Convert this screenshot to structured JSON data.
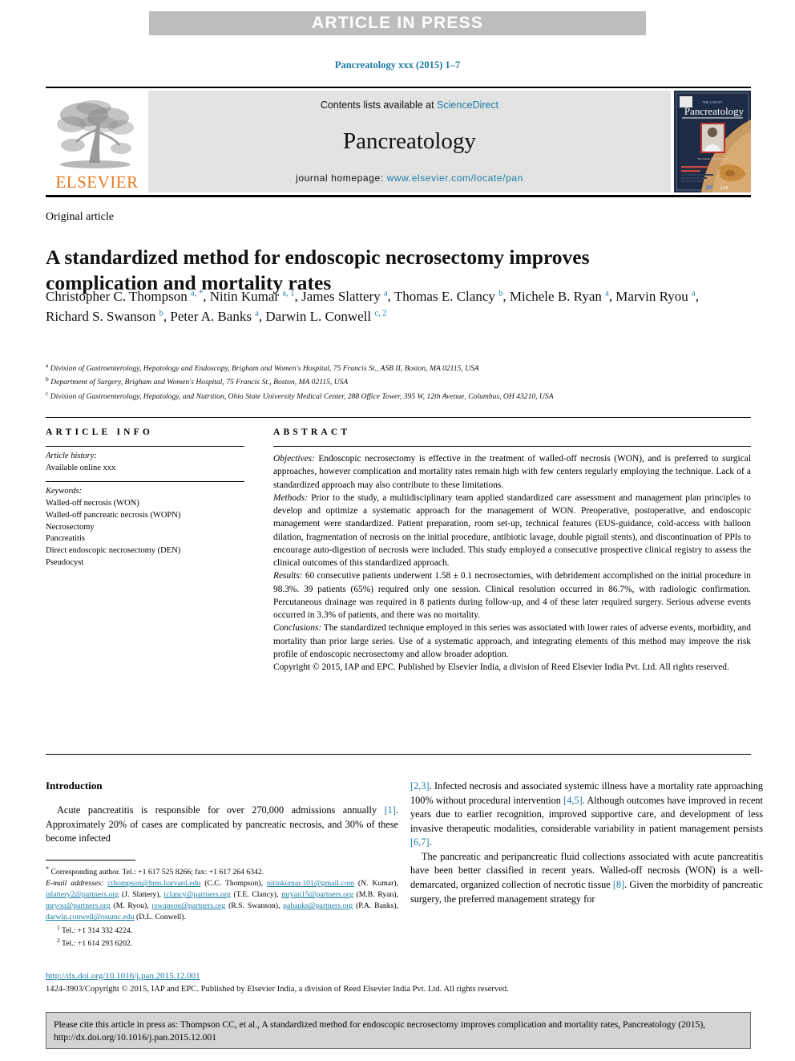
{
  "banner": {
    "text": "ARTICLE IN PRESS"
  },
  "journal_ref": "Pancreatology xxx (2015) 1–7",
  "masthead": {
    "publisher_word": "ELSEVIER",
    "contents_prefix": "Contents lists available at ",
    "contents_link": "ScienceDirect",
    "journal_name": "Pancreatology",
    "homepage_prefix": "journal homepage: ",
    "homepage_link": "www.elsevier.com/locate/pan",
    "cover_title": "Pancreatology",
    "cover_top_label": "THE LANCET"
  },
  "article": {
    "doctype": "Original article",
    "title": "A standardized method for endoscopic necrosectomy improves complication and mortality rates",
    "authors_html": "Christopher C. Thompson <sup>a, *</sup>, Nitin Kumar <sup>a, 1</sup>, James Slattery <sup>a</sup>, Thomas E. Clancy <sup>b</sup>, Michele B. Ryan <sup>a</sup>, Marvin Ryou <sup>a</sup>, Richard S. Swanson <sup>b</sup>, Peter A. Banks <sup>a</sup>, Darwin L. Conwell <sup>c, 2</sup>",
    "affiliations": [
      {
        "marker": "a",
        "text": "Division of Gastroenterology, Hepatology and Endoscopy, Brigham and Women's Hospital, 75 Francis St., ASB II, Boston, MA 02115, USA"
      },
      {
        "marker": "b",
        "text": "Department of Surgery, Brigham and Women's Hospital, 75 Francis St., Boston, MA 02115, USA"
      },
      {
        "marker": "c",
        "text": "Division of Gastroenterology, Hepatology, and Nutrition, Ohio State University Medical Center, 288 Office Tower, 395 W, 12th Avenue, Columbus, OH 43210, USA"
      }
    ]
  },
  "article_info": {
    "heading": "ARTICLE INFO",
    "history_label": "Article history:",
    "history_value": "Available online xxx",
    "keywords_label": "Keywords:",
    "keywords": [
      "Walled-off necrosis (WON)",
      "Walled-off pancreatic necrosis (WOPN)",
      "Necrosectomy",
      "Pancreatitis",
      "Direct endoscopic necrosectomy (DEN)",
      "Pseudocyst"
    ]
  },
  "abstract": {
    "heading": "ABSTRACT",
    "objectives_label": "Objectives:",
    "objectives_text": " Endoscopic necrosectomy is effective in the treatment of walled-off necrosis (WON), and is preferred to surgical approaches, however complication and mortality rates remain high with few centers regularly employing the technique. Lack of a standardized approach may also contribute to these limitations.",
    "methods_label": "Methods:",
    "methods_text": " Prior to the study, a multidisciplinary team applied standardized care assessment and management plan principles to develop and optimize a systematic approach for the management of WON. Preoperative, postoperative, and endoscopic management were standardized. Patient preparation, room set-up, technical features (EUS-guidance, cold-access with balloon dilation, fragmentation of necrosis on the initial procedure, antibiotic lavage, double pigtail stents), and discontinuation of PPIs to encourage auto-digestion of necrosis were included. This study employed a consecutive prospective clinical registry to assess the clinical outcomes of this standardized approach.",
    "results_label": "Results:",
    "results_text": " 60 consecutive patients underwent 1.58 ± 0.1 necrosectomies, with debridement accomplished on the initial procedure in 98.3%. 39 patients (65%) required only one session. Clinical resolution occurred in 86.7%, with radiologic confirmation. Percutaneous drainage was required in 8 patients during follow-up, and 4 of these later required surgery. Serious adverse events occurred in 3.3% of patients, and there was no mortality.",
    "conclusions_label": "Conclusions:",
    "conclusions_text": " The standardized technique employed in this series was associated with lower rates of adverse events, morbidity, and mortality than prior large series. Use of a systematic approach, and integrating elements of this method may improve the risk profile of endoscopic necrosectomy and allow broader adoption.",
    "copyright": "Copyright © 2015, IAP and EPC. Published by Elsevier India, a division of Reed Elsevier India Pvt. Ltd. All rights reserved."
  },
  "introduction": {
    "heading": "Introduction",
    "p1_a": "Acute pancreatitis is responsible for over 270,000 admissions annually ",
    "p1_cite1": "[1]",
    "p1_b": ". Approximately 20% of cases are complicated by pancreatic necrosis, and 30% of these become infected ",
    "p1_cite2": "[2,3]",
    "p1_c": ". Infected necrosis and associated systemic illness have a mortality rate approaching 100% without procedural intervention ",
    "p1_cite3": "[4,5]",
    "p1_d": ". Although outcomes have improved in recent years due to earlier recognition, improved supportive care, and development of less invasive therapeutic modalities, considerable variability in patient management persists ",
    "p1_cite4": "[6,7]",
    "p1_e": ".",
    "p2_a": "The pancreatic and peripancreatic fluid collections associated with acute pancreatitis have been better classified in recent years. Walled-off necrosis (WON) is a well-demarcated, organized collection of necrotic tissue ",
    "p2_cite1": "[8]",
    "p2_b": ". Given the morbidity of pancreatic surgery, the preferred management strategy for"
  },
  "footnotes": {
    "corresponding": "Corresponding author. Tel.: +1 617 525 8266; fax: +1 617 264 6342.",
    "email_label": "E-mail addresses:",
    "emails": [
      {
        "address": "cthompson@hms.harvard.edu",
        "owner": " (C.C. Thompson), "
      },
      {
        "address": "nitinkumar.101@gmail.com",
        "owner": " (N. Kumar), "
      },
      {
        "address": "jslattery2@partners.org",
        "owner": " (J. Slattery), "
      },
      {
        "address": "tclancy@partners.org",
        "owner": " (T.E. Clancy), "
      },
      {
        "address": "mryan15@partners.org",
        "owner": " (M.B. Ryan), "
      },
      {
        "address": "mryou@partners.org",
        "owner": " (M. Ryou), "
      },
      {
        "address": "rswanson@partners.org",
        "owner": " (R.S. Swanson), "
      },
      {
        "address": "pabanks@partners.org",
        "owner": " (P.A. Banks), "
      },
      {
        "address": "darwin.conwell@osumc.edu",
        "owner": " (D.L. Conwell)."
      }
    ],
    "tel1_marker": "1",
    "tel1": " Tel.: +1 314 332 4224.",
    "tel2_marker": "2",
    "tel2": " Tel.: +1 614 293 6202."
  },
  "footer": {
    "doi": "http://dx.doi.org/10.1016/j.pan.2015.12.001",
    "issn_copyright": "1424-3903/Copyright © 2015, IAP and EPC. Published by Elsevier India, a division of Reed Elsevier India Pvt. Ltd. All rights reserved."
  },
  "cite_box": {
    "text": "Please cite this article in press as: Thompson CC, et al., A standardized method for endoscopic necrosectomy improves complication and mortality rates, Pancreatology (2015), http://dx.doi.org/10.1016/j.pan.2015.12.001"
  },
  "colors": {
    "accent_blue": "#1b7ba6",
    "elsevier_orange": "#E87722",
    "banner_gray": "#bdbdbd",
    "masthead_gray": "#e3e3e3",
    "citebox_gray": "#d4d4d4"
  }
}
